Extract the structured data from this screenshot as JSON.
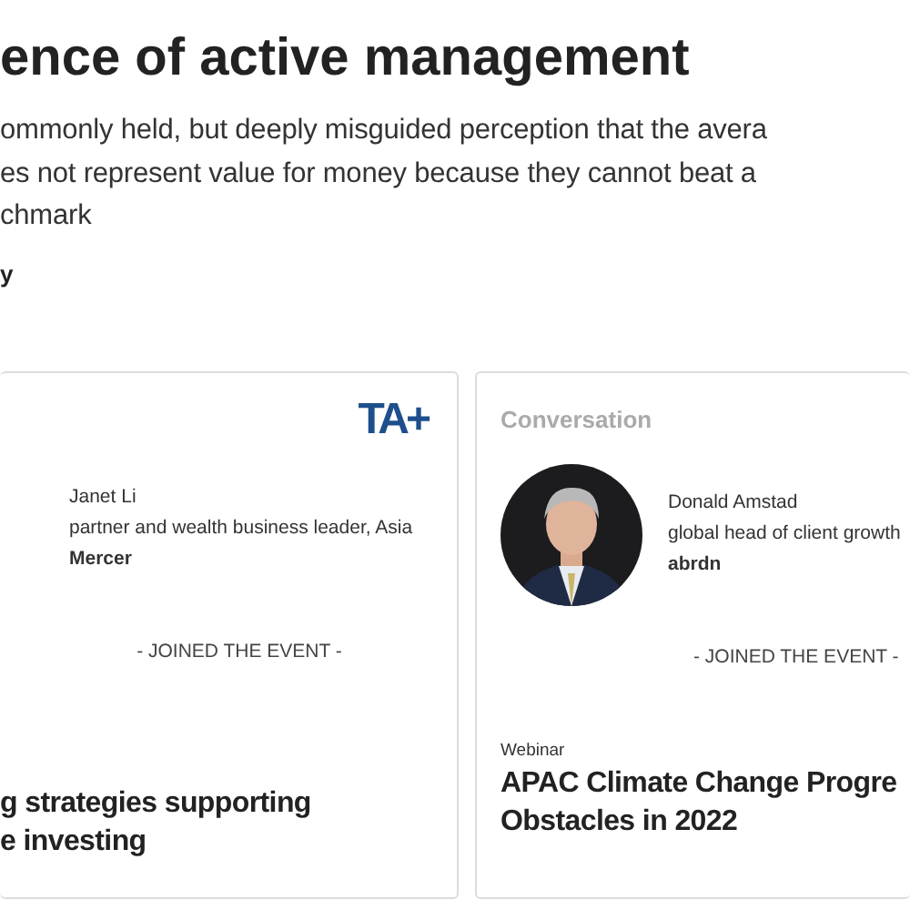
{
  "article": {
    "title": "ence of active management",
    "summary_lines": [
      "ommonly held, but deeply misguided perception that the avera",
      "es not represent value for money because they cannot beat a",
      "chmark"
    ],
    "byline": "y"
  },
  "cards": [
    {
      "logo": {
        "mark": "TA+"
      },
      "speaker": {
        "name": "Janet Li",
        "role": "partner and wealth business leader, Asia",
        "company": "Mercer"
      },
      "status": "- JOINED THE EVENT -",
      "title_lines": [
        "g strategies supporting",
        "e investing"
      ]
    },
    {
      "label": "Conversation",
      "photo": {
        "kind": "picture"
      },
      "speaker": {
        "name": "Donald Amstad",
        "role": "global head of client growth",
        "company": "abrdn"
      },
      "status": "- JOINED THE EVENT -",
      "type": "Webinar",
      "title_lines": [
        "APAC Climate Change Progre",
        "Obstacles in 2022"
      ]
    }
  ]
}
